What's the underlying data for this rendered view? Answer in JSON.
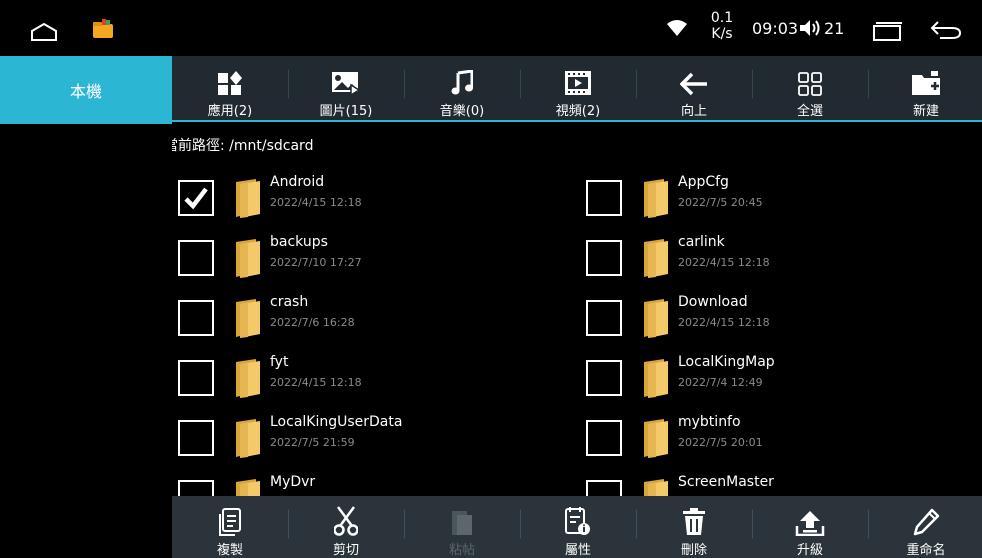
{
  "status_bar": {
    "net_speed_value": "0.1",
    "net_speed_unit": "K/s",
    "time": "09:03",
    "volume": "21",
    "icons": [
      "home-icon",
      "file-manager-app-icon",
      "wifi-icon",
      "volume-icon",
      "recent-apps-icon",
      "back-icon"
    ]
  },
  "sidebar": {
    "active_tab": "本機",
    "accent": "#2bb6d4"
  },
  "toolbar": {
    "items": [
      {
        "label": "應用(2)",
        "icon": "apps-icon"
      },
      {
        "label": "圖片(15)",
        "icon": "image-icon"
      },
      {
        "label": "音樂(0)",
        "icon": "music-icon"
      },
      {
        "label": "視頻(2)",
        "icon": "video-icon"
      },
      {
        "label": "向上",
        "icon": "arrow-up-back-icon"
      },
      {
        "label": "全選",
        "icon": "select-all-icon"
      },
      {
        "label": "新建",
        "icon": "new-folder-icon"
      }
    ]
  },
  "content": {
    "path": "當前路徑: /mnt/sdcard",
    "files": [
      {
        "name": "Android",
        "date": "2022/4/15 12:18",
        "checked": true
      },
      {
        "name": "AppCfg",
        "date": "2022/7/5 20:45",
        "checked": false
      },
      {
        "name": "backups",
        "date": "2022/7/10 17:27",
        "checked": false
      },
      {
        "name": "carlink",
        "date": "2022/4/15 12:18",
        "checked": false
      },
      {
        "name": "crash",
        "date": "2022/7/6 16:28",
        "checked": false
      },
      {
        "name": "Download",
        "date": "2022/4/15 12:18",
        "checked": false
      },
      {
        "name": "fyt",
        "date": "2022/4/15 12:18",
        "checked": false
      },
      {
        "name": "LocalKingMap",
        "date": "2022/7/4 12:49",
        "checked": false
      },
      {
        "name": "LocalKingUserData",
        "date": "2022/7/5 21:59",
        "checked": false
      },
      {
        "name": "mybtinfo",
        "date": "2022/7/5 20:01",
        "checked": false
      },
      {
        "name": "MyDvr",
        "date": "",
        "checked": false
      },
      {
        "name": "ScreenMaster",
        "date": "",
        "checked": false
      }
    ]
  },
  "bottom_bar": {
    "items": [
      {
        "label": "複製",
        "icon": "copy-icon",
        "enabled": true
      },
      {
        "label": "剪切",
        "icon": "scissors-icon",
        "enabled": true
      },
      {
        "label": "粘帖",
        "icon": "paste-icon",
        "enabled": false
      },
      {
        "label": "屬性",
        "icon": "properties-icon",
        "enabled": true
      },
      {
        "label": "刪除",
        "icon": "trash-icon",
        "enabled": true
      },
      {
        "label": "升級",
        "icon": "upgrade-icon",
        "enabled": true
      },
      {
        "label": "重命名",
        "icon": "pencil-icon",
        "enabled": true
      }
    ]
  }
}
